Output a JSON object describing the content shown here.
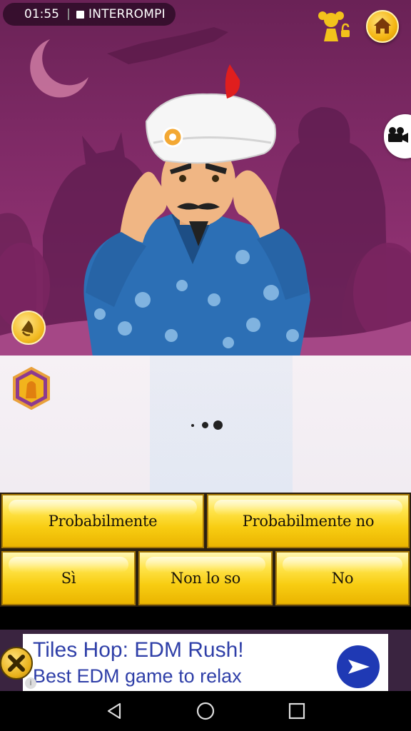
{
  "recording": {
    "time": "01:55",
    "action_label": "INTERROMPI"
  },
  "icons": {
    "home": "home-icon",
    "locked_character": "girl-lock-icon",
    "video": "camera-icon",
    "sound": "horn-icon",
    "badge": "character-badge-icon",
    "ad_close": "close-icon",
    "ad_play": "play-icon",
    "ad_info": "info-icon",
    "nav_back": "back-triangle-icon",
    "nav_home": "home-circle-icon",
    "nav_recents": "recents-square-icon"
  },
  "status": {
    "thinking_indicator": "•••"
  },
  "answers": {
    "probably": "Probabilmente",
    "probably_not": "Probabilmente no",
    "yes": "Sì",
    "dont_know": "Non lo so",
    "no": "No"
  },
  "ad": {
    "title": "Tiles Hop: EDM Rush!",
    "subtitle": "Best EDM game to relax",
    "info": "i"
  },
  "colors": {
    "background_purple": "#7f2a66",
    "button_gold": "#f8cd12",
    "ad_blue": "#2f3fa8"
  }
}
